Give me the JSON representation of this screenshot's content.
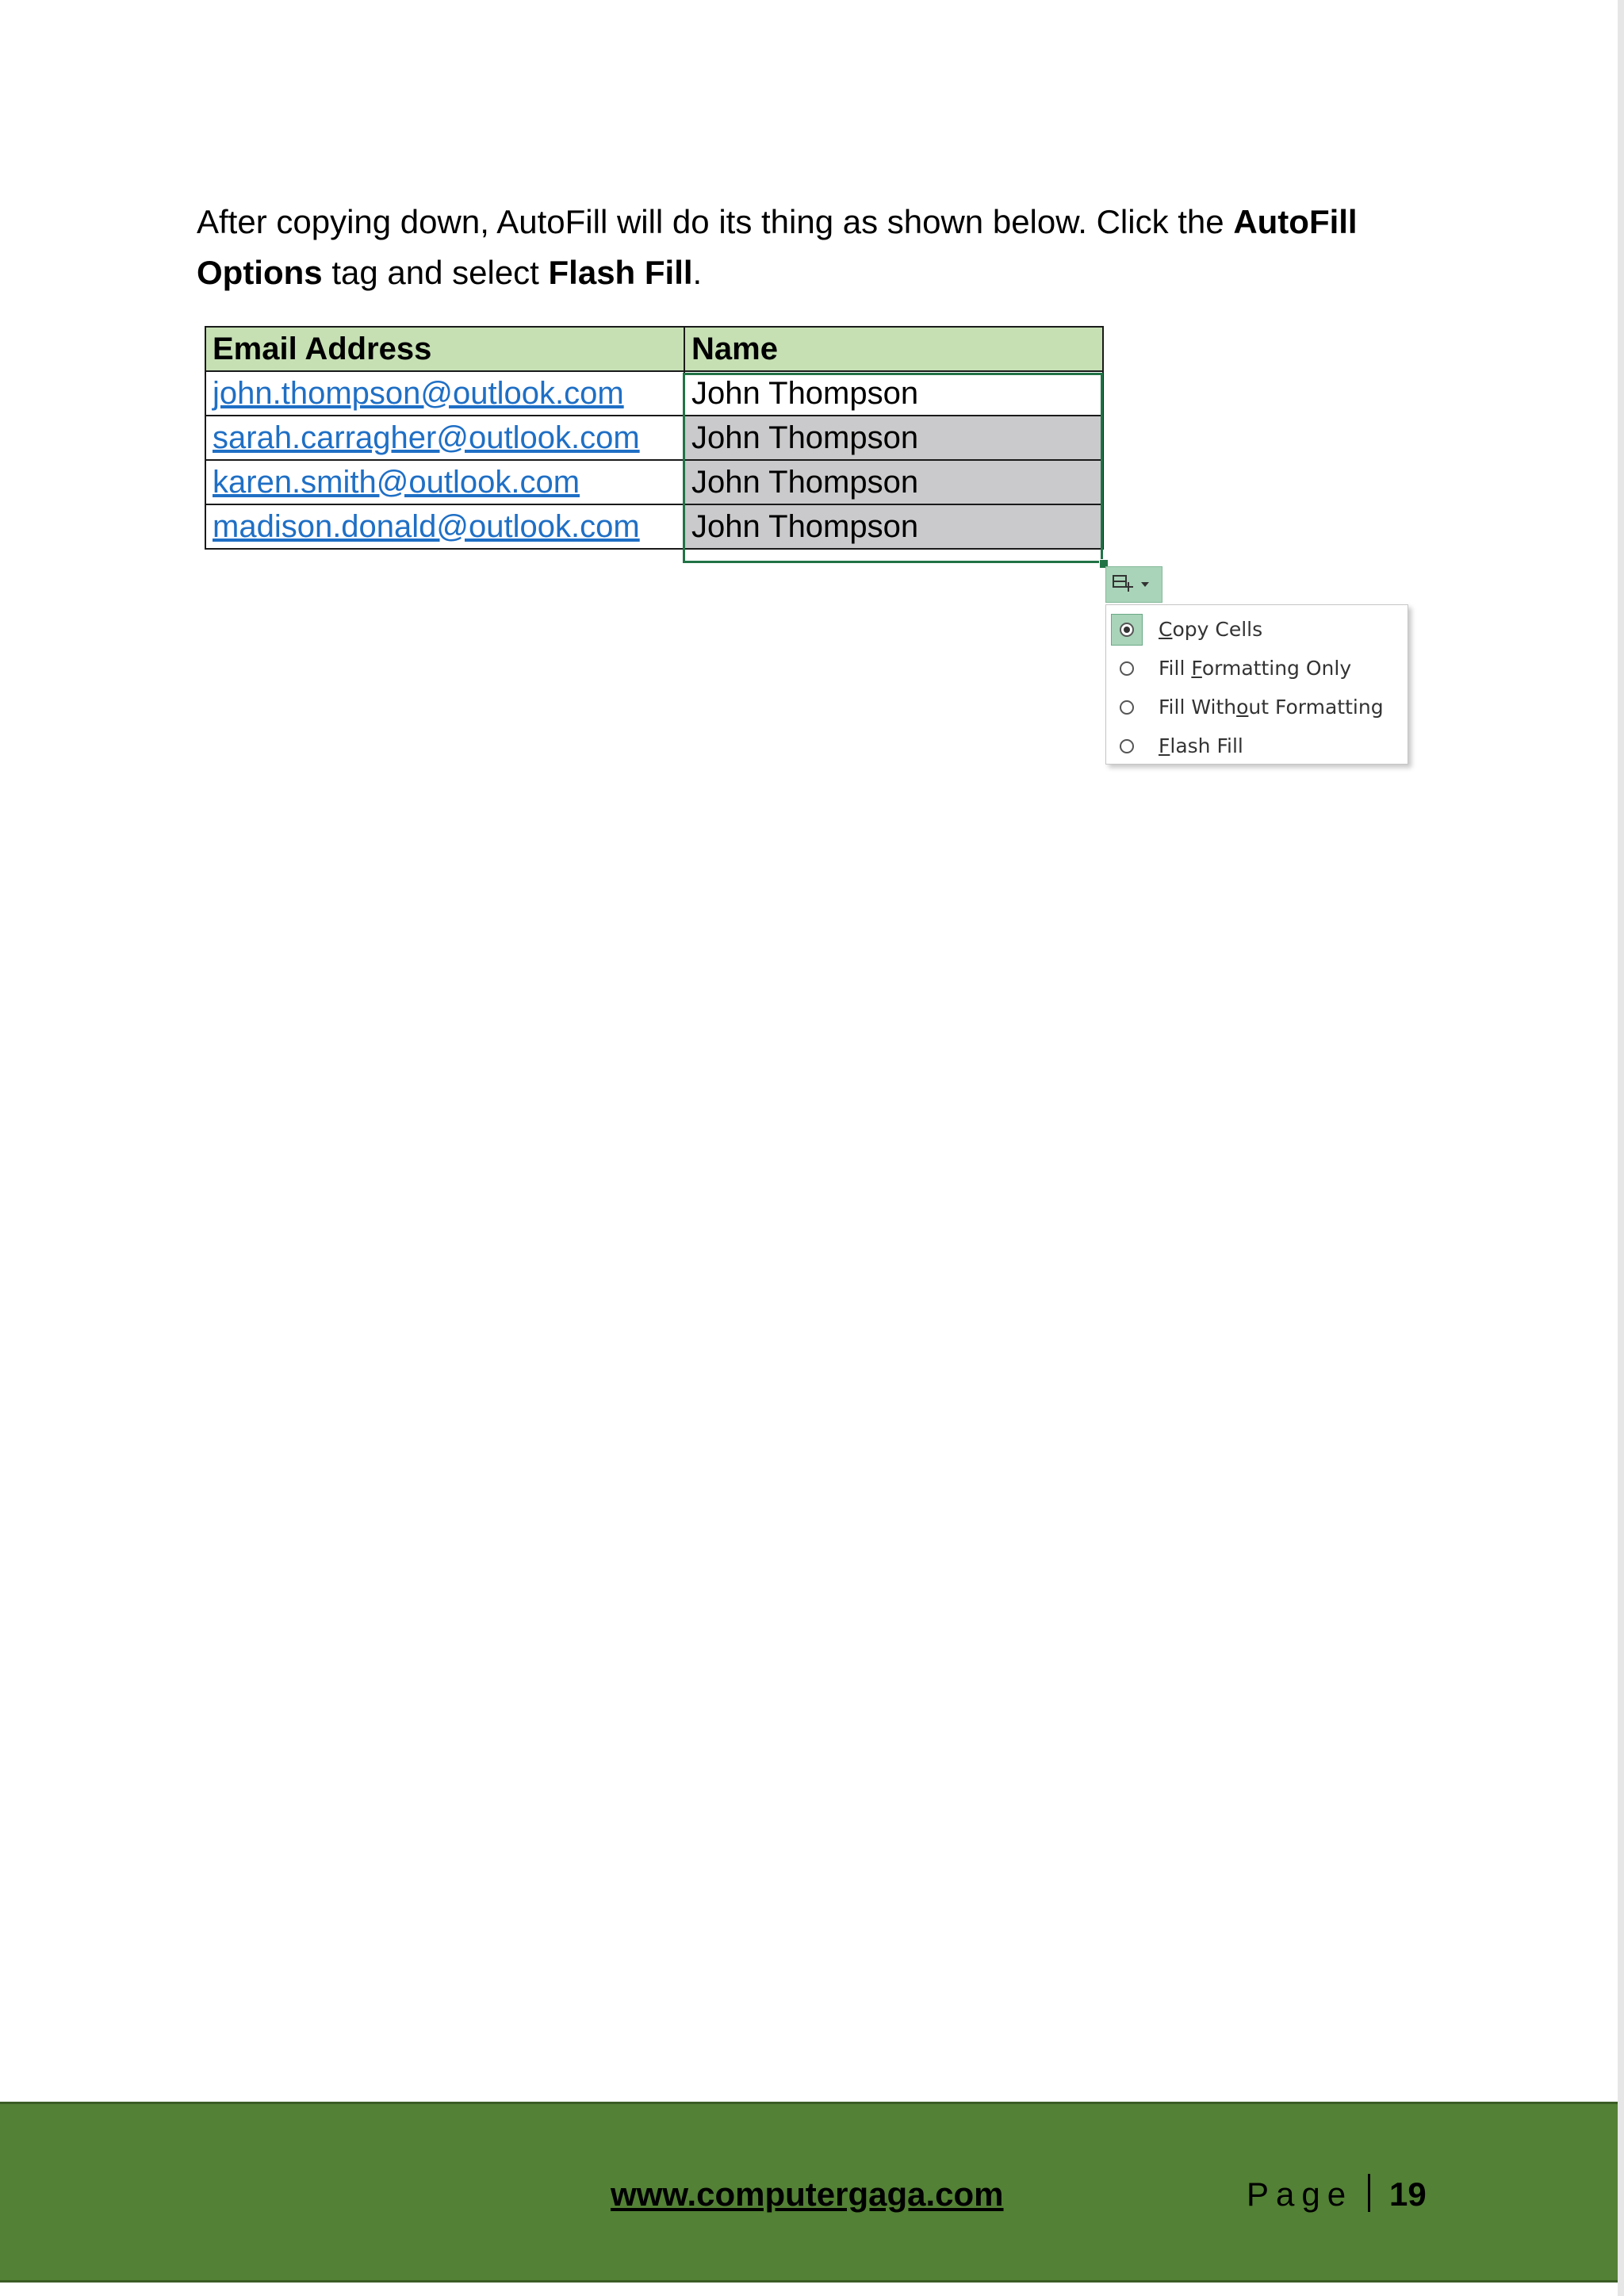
{
  "paragraph": {
    "t1": "After copying down, AutoFill will do its thing as shown below. Click the ",
    "b1": "AutoFill Options",
    "t2": " tag and select ",
    "b2": "Flash Fill",
    "t3": "."
  },
  "table": {
    "headers": [
      "Email Address",
      "Name"
    ],
    "rows": [
      {
        "email": "john.thompson@outlook.com",
        "name": "John Thompson"
      },
      {
        "email": "sarah.carragher@outlook.com",
        "name": "John Thompson"
      },
      {
        "email": "karen.smith@outlook.com",
        "name": "John Thompson"
      },
      {
        "email": "madison.donald@outlook.com",
        "name": "John Thompson"
      }
    ]
  },
  "autofill_menu": {
    "icon": "autofill-options-icon",
    "items": [
      {
        "label": "Copy Cells",
        "selected": true
      },
      {
        "label": "Fill Formatting Only",
        "selected": false
      },
      {
        "label": "Fill Without Formatting",
        "selected": false
      },
      {
        "label": "Flash Fill",
        "selected": false
      }
    ]
  },
  "footer": {
    "website": "www.computergaga.com",
    "page_label": "Page",
    "page_number": "19"
  },
  "colors": {
    "header_fill": "#c6e0b4",
    "link": "#1f6fc5",
    "copied_fill": "#cac9cb",
    "selection": "#217346",
    "footer": "#538135"
  }
}
